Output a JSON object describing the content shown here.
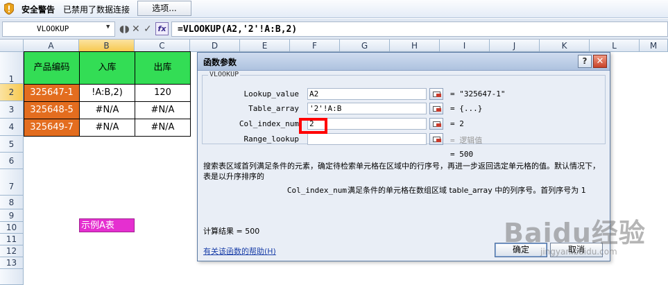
{
  "security_bar": {
    "title": "安全警告",
    "message": "已禁用了数据连接",
    "options_button": "选项..."
  },
  "formula_bar": {
    "name_box": "VLOOKUP",
    "cancel_glyph": "✕",
    "enter_glyph": "✓",
    "fx_label": "fx",
    "formula": "=VLOOKUP(A2,'2'!A:B,2)"
  },
  "columns": [
    "A",
    "B",
    "C",
    "D",
    "E",
    "F",
    "G",
    "H",
    "I",
    "J",
    "K",
    "L",
    "M"
  ],
  "rows": [
    "1",
    "2",
    "3",
    "4",
    "5",
    "6",
    "7",
    "8",
    "9",
    "10",
    "11",
    "12",
    "13"
  ],
  "cells": {
    "A1": "产品编码",
    "B1": "入库",
    "C1": "出库",
    "A2": "325647-1",
    "B2": "!A:B,2)",
    "C2": "120",
    "A3": "325648-5",
    "B3": "#N/A",
    "C3": "#N/A",
    "A4": "325649-7",
    "B4": "#N/A",
    "C4": "#N/A",
    "B10": "示例A表"
  },
  "dialog": {
    "title": "函数参数",
    "help_glyph": "?",
    "close_glyph": "✕",
    "function_name": "VLOOKUP",
    "args": [
      {
        "label": "Lookup_value",
        "value": "A2",
        "result": "= \"325647-1\""
      },
      {
        "label": "Table_array",
        "value": "'2'!A:B",
        "result": "= {...}"
      },
      {
        "label": "Col_index_num",
        "value": "2",
        "result": "= 2"
      },
      {
        "label": "Range_lookup",
        "value": "",
        "result": "= 逻辑值"
      }
    ],
    "overall_result": "= 500",
    "description": "搜索表区域首列满足条件的元素，确定待检索单元格在区域中的行序号，再进一步返回选定单元格的值。默认情况下，表是以升序排序的",
    "arg_name": "Col_index_num",
    "arg_desc": "满足条件的单元格在数组区域 table_array 中的列序号。首列序号为 1",
    "calc_result": "计算结果 = 500",
    "help_link": "有关该函数的帮助(H)",
    "ok_button": "确定",
    "cancel_button": "取消"
  },
  "watermark": {
    "brand": "Baidu经验",
    "url": "jingyan.baidu.com"
  }
}
